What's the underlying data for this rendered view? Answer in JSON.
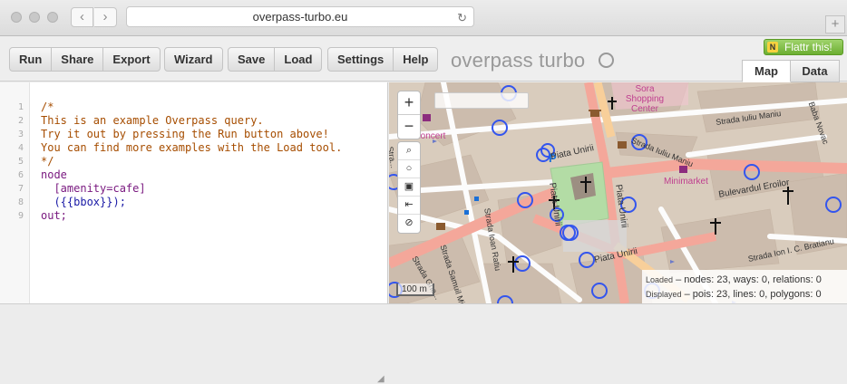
{
  "browser": {
    "url": "overpass-turbo.eu",
    "back_icon": "chevron-left-icon",
    "forward_icon": "chevron-right-icon",
    "reload_icon": "reload-icon",
    "newtab_label": "+"
  },
  "toolbar": {
    "run": "Run",
    "share": "Share",
    "export": "Export",
    "wizard": "Wizard",
    "save": "Save",
    "load": "Load",
    "settings": "Settings",
    "help": "Help"
  },
  "brand": {
    "name": "overpass turbo"
  },
  "flattr": {
    "label": "Flattr this!",
    "badge": "N"
  },
  "tabs": {
    "map": "Map",
    "data": "Data"
  },
  "editor": {
    "lines": [
      {
        "n": "1",
        "text": "/*"
      },
      {
        "n": "2",
        "text": "This is an example Overpass query."
      },
      {
        "n": "3",
        "text": "Try it out by pressing the Run button above!"
      },
      {
        "n": "4",
        "text": "You can find more examples with the Load tool."
      },
      {
        "n": "5",
        "text": "*/"
      },
      {
        "n": "6",
        "text": "node"
      },
      {
        "n": "7",
        "text": "  [amenity=cafe]"
      },
      {
        "n": "8",
        "text": "  ({{bbox}});"
      },
      {
        "n": "9",
        "text": "out;"
      }
    ]
  },
  "map": {
    "zoom_in": "+",
    "zoom_out": "−",
    "tools": [
      "⌕",
      "○",
      "▣",
      "⇤",
      "⊘"
    ],
    "scale": "100 m",
    "labels": {
      "sora": "Sora Shopping Center",
      "baba": "Baba Novac",
      "koncert": "Koncert",
      "iuliu1": "Strada Iuliu Maniu",
      "iuliu2": "Strada Iuliu Maniu",
      "piata1": "Piata Unirii",
      "piata2": "Piata Unirii",
      "piata3": "Piata Unirii",
      "piata4": "Piata Unirii",
      "minimarket": "Minimarket",
      "bulevardul": "Bulevardul Eroilor",
      "ioanratiu": "Strada Ioan Ratiu",
      "samuil": "Strada Samuil Micu",
      "ghe": "Strada Ghe...",
      "bratianu": "Strada Ion I. C. Bratianu",
      "str": "Stra..."
    },
    "stats": {
      "loaded_label": "Loaded",
      "loaded_value": "– nodes: 23, ways: 0, relations: 0",
      "displayed_label": "Displayed",
      "displayed_value": "– pois: 23, lines: 0, polygons: 0"
    },
    "colors": {
      "marker": "#3355ee",
      "road": "#f9b3a8",
      "road_main": "#e79797",
      "green": "#b3dca5"
    }
  }
}
